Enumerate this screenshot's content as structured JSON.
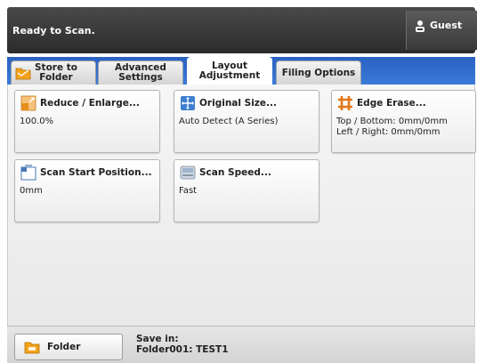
{
  "header": {
    "status": "Ready to Scan.",
    "guest_label": "Guest"
  },
  "tabs": [
    {
      "line1": "Store to",
      "line2": "Folder",
      "active": false
    },
    {
      "line1": "Advanced",
      "line2": "Settings",
      "active": false
    },
    {
      "line1": "Layout",
      "line2": "Adjustment",
      "active": true
    },
    {
      "line1": "Filing Options",
      "line2": "",
      "active": false
    }
  ],
  "cards": {
    "reduce_enlarge": {
      "title": "Reduce / Enlarge...",
      "value": "100.0%"
    },
    "original_size": {
      "title": "Original Size...",
      "value": "Auto Detect (A Series)"
    },
    "edge_erase": {
      "title": "Edge Erase...",
      "value_line1": "Top / Bottom: 0mm/0mm",
      "value_line2": "Left / Right: 0mm/0mm"
    },
    "scan_start_position": {
      "title": "Scan Start Position...",
      "value": "0mm"
    },
    "scan_speed": {
      "title": "Scan Speed...",
      "value": "Fast"
    }
  },
  "footer": {
    "folder_label": "Folder",
    "save_in_label": "Save in:",
    "save_in_value": "Folder001: TEST1"
  },
  "colors": {
    "header_dark": "#2b2b2b",
    "tab_bar_blue": "#2a62c2",
    "folder_orange": "#f2a21b"
  }
}
